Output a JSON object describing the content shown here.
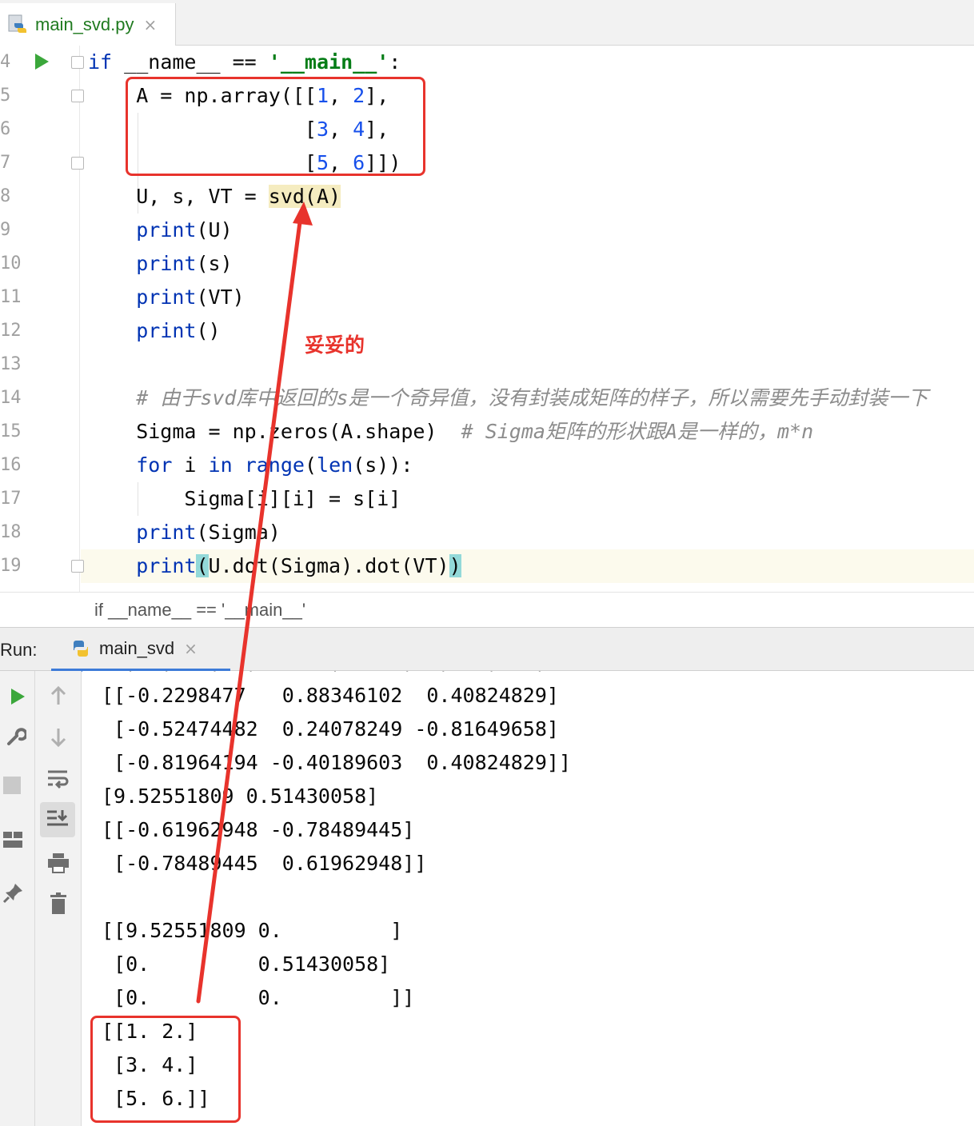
{
  "file_tab": {
    "label": "main_svd.py",
    "close": "×",
    "icon": "python-file-icon"
  },
  "code_lines": [
    {
      "n": "4",
      "html": "<span class=\"kw\">if</span> __name__ == <span class=\"str\">'__main__'</span>:"
    },
    {
      "n": "5",
      "html": "    A = np.array([[<span class=\"num\">1</span>, <span class=\"num\">2</span>],"
    },
    {
      "n": "6",
      "html": "                  [<span class=\"num\">3</span>, <span class=\"num\">4</span>],"
    },
    {
      "n": "7",
      "html": "                  [<span class=\"num\">5</span>, <span class=\"num\">6</span>]])"
    },
    {
      "n": "8",
      "html": "    U, s, VT = <span class=\"hl\">svd(A)</span>"
    },
    {
      "n": "9",
      "html": "    <span class=\"kw\">print</span>(U)"
    },
    {
      "n": "10",
      "html": "    <span class=\"kw\">print</span>(s)"
    },
    {
      "n": "11",
      "html": "    <span class=\"kw\">print</span>(VT)"
    },
    {
      "n": "12",
      "html": "    <span class=\"kw\">print</span>()"
    },
    {
      "n": "13",
      "html": ""
    },
    {
      "n": "14",
      "html": "    <span class=\"cmt\"># 由于svd库中返回的s是一个奇异值，没有封装成矩阵的样子，所以需要先手动封装一下</span>"
    },
    {
      "n": "15",
      "html": "    Sigma = np.zeros(A.shape)  <span class=\"cmt\"># Sigma矩阵的形状跟A是一样的，m*n</span>"
    },
    {
      "n": "16",
      "html": "    <span class=\"kw\">for</span> i <span class=\"kw\">in</span> <span class=\"kw\">range</span>(<span class=\"kw\">len</span>(s)):"
    },
    {
      "n": "17",
      "html": "        Sigma[i][i] = s[i]"
    },
    {
      "n": "18",
      "html": "    <span class=\"kw\">print</span>(Sigma)"
    },
    {
      "n": "19",
      "html": "    <span class=\"kw\">print</span><span class=\"brace\">(</span>U.dot(Sigma).dot(VT)<span class=\"brace\">)</span>"
    }
  ],
  "breadcrumb": "if __name__ == '__main__'",
  "run_panel": {
    "title": "Run:",
    "tab_label": "main_svd",
    "tab_close": "×",
    "tools_left": [
      "run-icon",
      "wrench-icon",
      "stop-icon",
      "layout-icon",
      "pin-icon"
    ],
    "tools_right": [
      "arrow-up-icon",
      "arrow-down-icon",
      "soft-wrap-icon",
      "scroll-to-end-icon",
      "print-icon",
      "trash-icon"
    ]
  },
  "console_lines": [
    "[[-0.2298477   0.88346102  0.40824829]",
    " [-0.52474482  0.24078249 -0.81649658]",
    " [-0.81964194 -0.40189603  0.40824829]]",
    "[9.52551809 0.51430058]",
    "[[-0.61962948 -0.78489445]",
    " [-0.78489445  0.61962948]]",
    "",
    "[[9.52551809 0.         ]",
    " [0.         0.51430058]",
    " [0.         0.         ]]",
    "[[1. 2.]",
    " [3. 4.]",
    " [5. 6.]]"
  ],
  "annotation_label": "妥妥的",
  "colors": {
    "annotation": "#e8332c",
    "keyword": "#0033b3",
    "string": "#067d17",
    "number": "#1750eb",
    "comment": "#8c8c8c"
  }
}
